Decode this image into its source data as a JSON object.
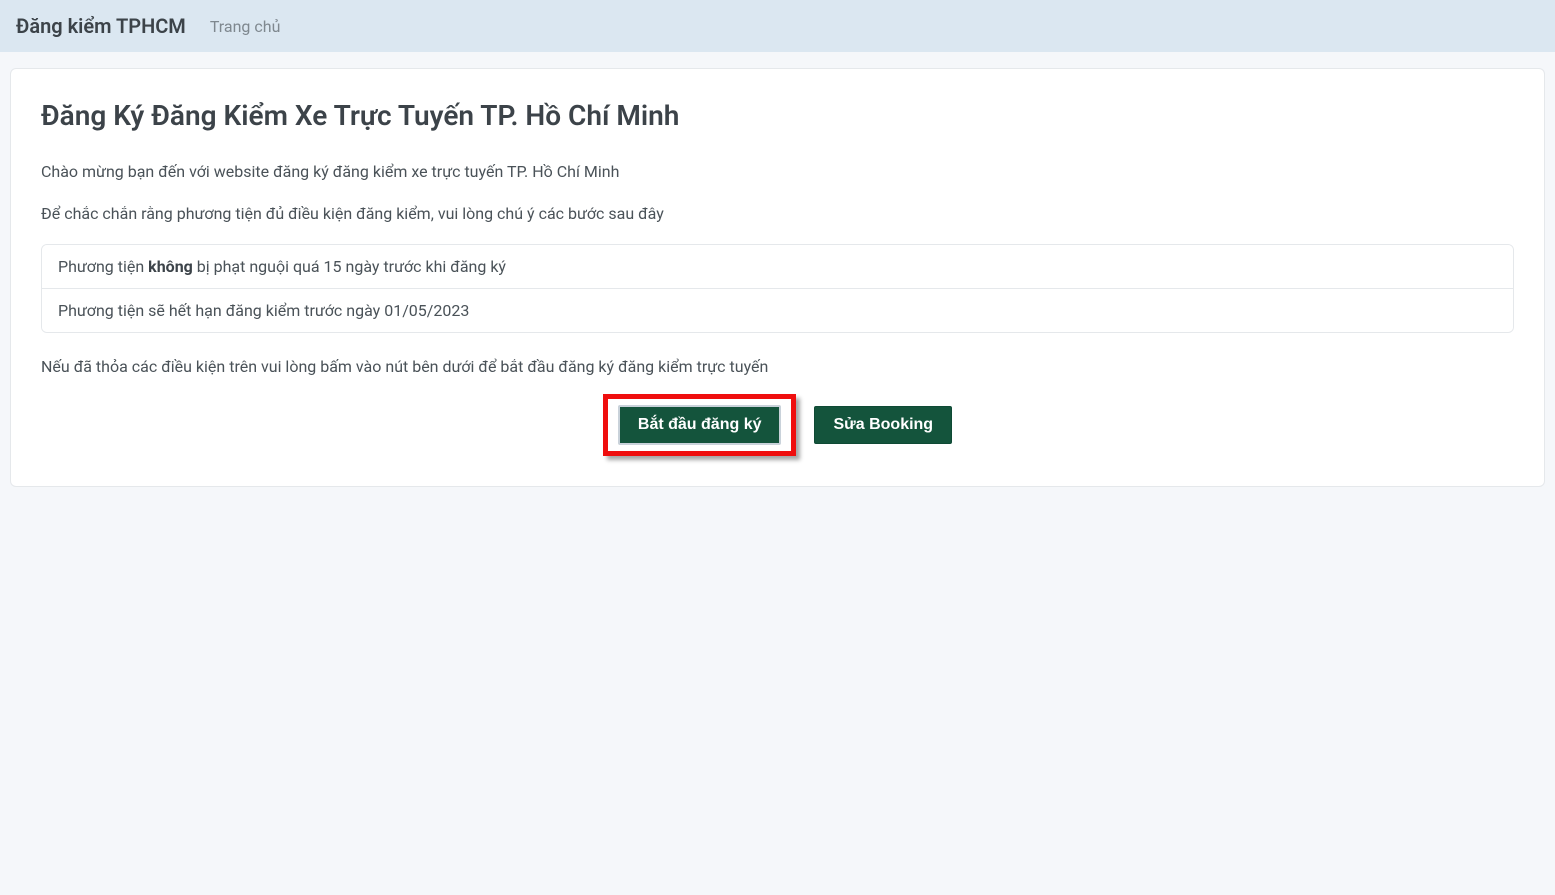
{
  "navbar": {
    "brand": "Đăng kiểm TPHCM",
    "home_link": "Trang chủ"
  },
  "main": {
    "title": "Đăng Ký Đăng Kiểm Xe Trực Tuyến TP. Hồ Chí Minh",
    "intro1": "Chào mừng bạn đến với website đăng ký đăng kiểm xe trực tuyến TP. Hồ Chí Minh",
    "intro2": "Để chắc chắn rằng phương tiện đủ điều kiện đăng kiểm, vui lòng chú ý các bước sau đây",
    "requirements": [
      {
        "prefix": "Phương tiện ",
        "bold": "không",
        "suffix": " bị phạt nguội quá 15 ngày trước khi đăng ký"
      },
      {
        "prefix": "Phương tiện sẽ hết hạn đăng kiểm trước ngày 01/05/2023",
        "bold": "",
        "suffix": ""
      }
    ],
    "cta_text": "Nếu đã thỏa các điều kiện trên vui lòng bấm vào nút bên dưới để bắt đầu đăng ký đăng kiểm trực tuyến",
    "start_button": "Bắt đầu đăng ký",
    "edit_button": "Sửa Booking"
  }
}
